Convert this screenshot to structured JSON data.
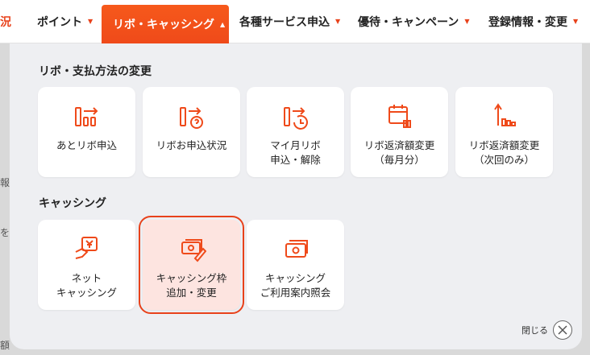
{
  "nav": {
    "items": [
      {
        "label": "況",
        "has_caret": false
      },
      {
        "label": "ポイント",
        "has_caret": true
      },
      {
        "label": "リボ・キャッシング",
        "has_caret": true,
        "active": true
      },
      {
        "label": "各種サービス申込",
        "has_caret": true
      },
      {
        "label": "優待・キャンペーン",
        "has_caret": true
      },
      {
        "label": "登録情報・変更",
        "has_caret": true
      }
    ]
  },
  "background": {
    "fragment1": "報",
    "fragment2": "を",
    "fragment3": "額"
  },
  "panel": {
    "section1_title": "リボ・支払方法の変更",
    "section1_cards": [
      {
        "label": "あとリボ申込",
        "icon": "revo-apply-icon"
      },
      {
        "label": "リボお申込状況",
        "icon": "revo-status-icon"
      },
      {
        "label": "マイ月リボ\n申込・解除",
        "icon": "my-revo-icon"
      },
      {
        "label": "リボ返済額変更\n（毎月分）",
        "icon": "calendar-bars-icon"
      },
      {
        "label": "リボ返済額変更\n（次回のみ）",
        "icon": "arrow-bars-icon"
      }
    ],
    "section2_title": "キャッシング",
    "section2_cards": [
      {
        "label": "ネット\nキャッシング",
        "icon": "yen-hand-icon"
      },
      {
        "label": "キャッシング枠\n追加・変更",
        "icon": "cash-edit-icon",
        "selected": true
      },
      {
        "label": "キャッシング\nご利用案内照会",
        "icon": "cash-info-icon"
      }
    ],
    "close_label": "閉じる"
  },
  "colors": {
    "accent": "#ef4a1a",
    "selected_bg": "#fde4e0",
    "panel_bg": "#eeeff2"
  }
}
